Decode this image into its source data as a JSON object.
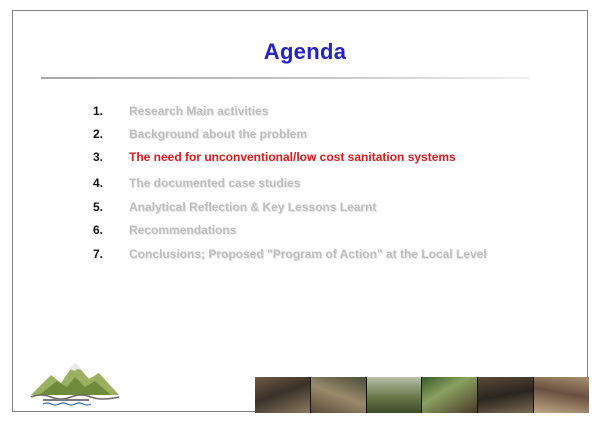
{
  "slide": {
    "title": "Agenda",
    "items": [
      {
        "number": "1.",
        "text": "Research Main activities"
      },
      {
        "number": "2.",
        "text": "Background about the problem"
      },
      {
        "number": "3.",
        "text": "The need for unconventional/low cost sanitation systems"
      },
      {
        "number": "4.",
        "text": "The documented case studies"
      },
      {
        "number": "5.",
        "text": "Analytical Reflection & Key Lessons Learnt"
      },
      {
        "number": "6.",
        "text": "Recommendations"
      },
      {
        "number": "7.",
        "text": "Conclusions; Proposed \"Program of Action\" at the Local Level"
      }
    ],
    "active_item_index": 2,
    "colors": {
      "title": "#2323c8",
      "active_item": "#d91a1a",
      "inactive_item": "#bdbdbd",
      "number": "#111111"
    }
  },
  "logo": {
    "icon": "mountain-water-logo-icon"
  },
  "photo_strip": {
    "icon": "sanitation-photos-strip"
  }
}
